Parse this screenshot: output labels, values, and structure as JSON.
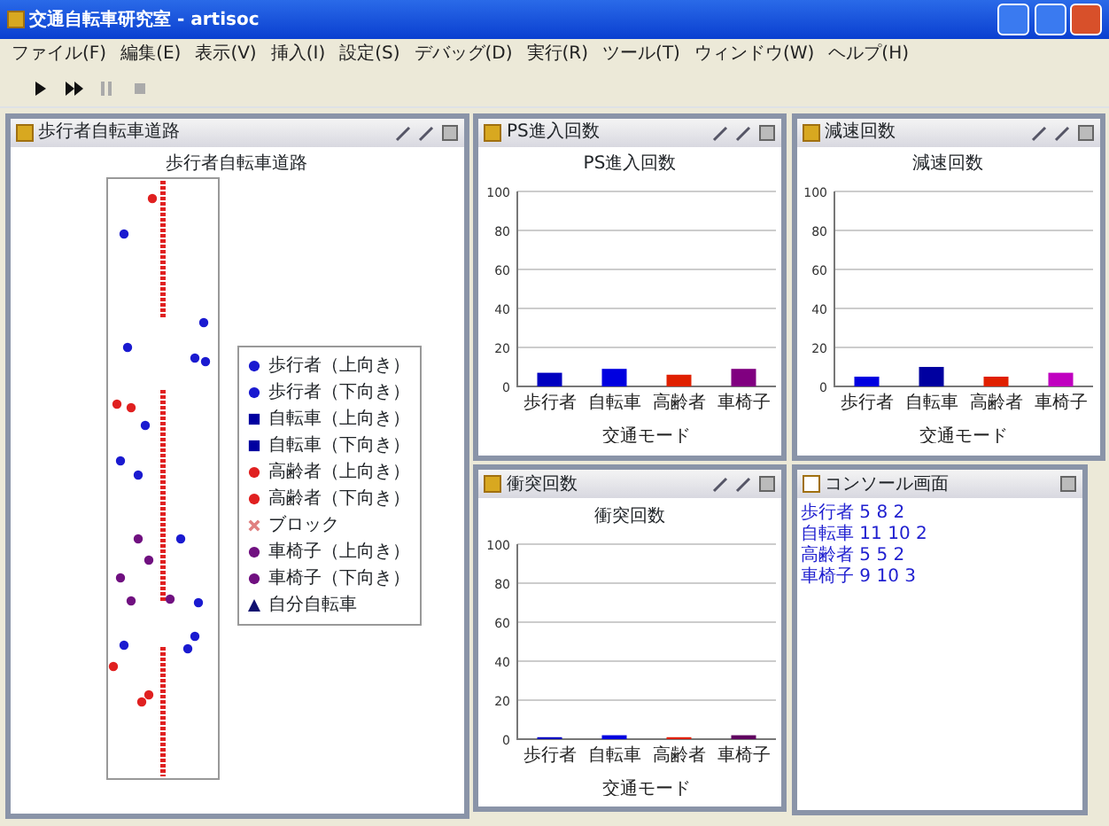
{
  "window": {
    "title": "交通自転車研究室 - artisoc"
  },
  "menu": [
    "ファイル(F)",
    "編集(E)",
    "表示(V)",
    "挿入(I)",
    "設定(S)",
    "デバッグ(D)",
    "実行(R)",
    "ツール(T)",
    "ウィンドウ(W)",
    "ヘルプ(H)"
  ],
  "toolbar": [
    {
      "kind": "play",
      "disabled": false
    },
    {
      "kind": "step",
      "disabled": false
    },
    {
      "kind": "pause",
      "disabled": true
    },
    {
      "kind": "stop",
      "disabled": true
    }
  ],
  "map_panel": {
    "title": "歩行者自転車道路",
    "map_title": "歩行者自転車道路",
    "legend": [
      {
        "label": "歩行者（上向き）",
        "color": "#1a1ad0",
        "kind": "dot"
      },
      {
        "label": "歩行者（下向き）",
        "color": "#1a1ad0",
        "kind": "dot"
      },
      {
        "label": "自転車（上向き）",
        "color": "#0000a0",
        "kind": "square"
      },
      {
        "label": "自転車（下向き）",
        "color": "#0000a0",
        "kind": "square"
      },
      {
        "label": "高齢者（上向き）",
        "color": "#e02020",
        "kind": "dot"
      },
      {
        "label": "高齢者（下向き）",
        "color": "#e02020",
        "kind": "dot"
      },
      {
        "label": "ブロック",
        "color": "#e08080",
        "kind": "cross"
      },
      {
        "label": "車椅子（上向き）",
        "color": "#701080",
        "kind": "dot"
      },
      {
        "label": "車椅子（下向き）",
        "color": "#701080",
        "kind": "dot"
      },
      {
        "label": "自分自転車",
        "color": "#101070",
        "kind": "triangle"
      }
    ]
  },
  "chart_panels": [
    {
      "title": "PS進入回数",
      "chart_data": {
        "type": "bar",
        "title": "PS進入回数",
        "xlabel": "交通モード",
        "categories": [
          "歩行者",
          "自転車",
          "高齢者",
          "車椅子"
        ],
        "series": [
          {
            "values": [
              7,
              9,
              6,
              9
            ]
          }
        ],
        "colors": [
          "#0000c0",
          "#0000e0",
          "#e02000",
          "#800080"
        ],
        "grid": true,
        "ylim": [
          0,
          100
        ],
        "yticks": [
          0,
          20,
          40,
          60,
          80,
          100
        ]
      }
    },
    {
      "title": "減速回数",
      "chart_data": {
        "type": "bar",
        "title": "減速回数",
        "xlabel": "交通モード",
        "categories": [
          "歩行者",
          "自転車",
          "高齢者",
          "車椅子"
        ],
        "series": [
          {
            "values": [
              5,
              10,
              5,
              7
            ]
          }
        ],
        "colors": [
          "#0000e0",
          "#0000a0",
          "#e02000",
          "#c000c0"
        ],
        "grid": true,
        "ylim": [
          0,
          100
        ],
        "yticks": [
          0,
          20,
          40,
          60,
          80,
          100
        ]
      }
    },
    {
      "title": "衝突回数",
      "chart_data": {
        "type": "bar",
        "title": "衝突回数",
        "xlabel": "交通モード",
        "categories": [
          "歩行者",
          "自転車",
          "高齢者",
          "車椅子"
        ],
        "series": [
          {
            "values": [
              1,
              2,
              1,
              2
            ]
          }
        ],
        "colors": [
          "#0000c0",
          "#0000e0",
          "#e02000",
          "#600060"
        ],
        "grid": true,
        "ylim": [
          0,
          100
        ],
        "yticks": [
          0,
          20,
          40,
          60,
          80,
          100
        ]
      }
    }
  ],
  "console": {
    "title": "コンソール画面",
    "lines": [
      "歩行者 5 8 2",
      "自転車 11 10 2",
      "高齢者 5 5 2",
      "車椅子 9 10 3"
    ]
  }
}
